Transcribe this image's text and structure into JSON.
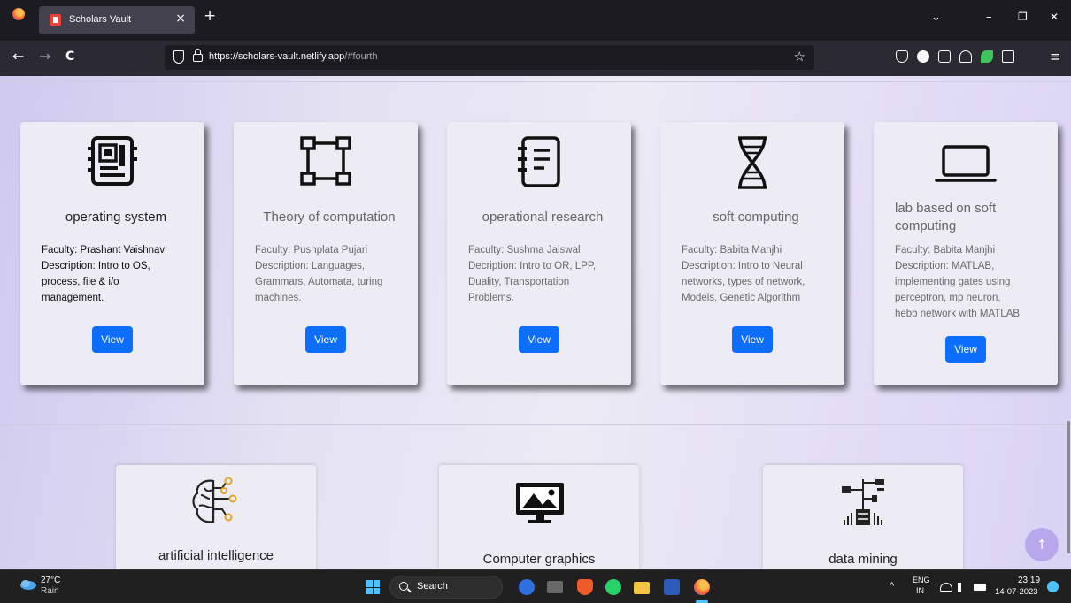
{
  "browser": {
    "tab_title": "Scholars Vault",
    "tab_close": "×",
    "new_tab": "+",
    "url_host": "https://scholars-vault.netlify.app",
    "url_path": "/#fourth",
    "nav_back": "←",
    "nav_forward": "→",
    "nav_reload": "C",
    "bookmark_star": "☆",
    "window_controls": {
      "list": "⌄",
      "minimize": "–",
      "restore": "❐",
      "close": "✕"
    },
    "menu": "≡"
  },
  "courses": [
    {
      "title": "operating system",
      "desc_lines": [
        "Faculty: Prashant Vaishnav",
        "Description: Intro to OS,",
        "process, file & i/o",
        "management."
      ],
      "button": "View",
      "icon": "circuit-board-icon"
    },
    {
      "title": "Theory of computation",
      "desc_lines": [
        "Faculty: Pushplata Pujari",
        "Description: Languages,",
        "Grammars, Automata, turing",
        "machines."
      ],
      "button": "View",
      "icon": "nodes-square-icon"
    },
    {
      "title": "operational research",
      "desc_lines": [
        "Faculty: Sushma Jaiswal",
        "Decription: Intro to OR, LPP,",
        "Duality, Transportation",
        "Problems."
      ],
      "button": "View",
      "icon": "notebook-icon"
    },
    {
      "title": "soft computing",
      "desc_lines": [
        "Faculty: Babita Manjhi",
        "Description: Intro to Neural",
        "networks, types of network,",
        "Models, Genetic Algorithm"
      ],
      "button": "View",
      "icon": "dna-icon"
    },
    {
      "title": "lab based on soft computing",
      "desc_lines": [
        "Faculty: Babita Manjhi",
        "Description: MATLAB,",
        "implementing gates using",
        "perceptron, mp neuron,",
        "hebb network with MATLAB"
      ],
      "button": "View",
      "icon": "laptop-icon"
    }
  ],
  "bottom_courses": [
    {
      "title": "artificial intelligence",
      "icon": "brain-circuit-icon"
    },
    {
      "title": "Computer graphics",
      "icon": "monitor-image-icon"
    },
    {
      "title": "data mining",
      "icon": "data-tree-icon"
    }
  ],
  "scroll_top": "↑",
  "taskbar": {
    "weather_temp": "27°C",
    "weather_desc": "Rain",
    "search_placeholder": "Search",
    "lang_top": "ENG",
    "lang_bottom": "IN",
    "time": "23:19",
    "date": "14-07-2023",
    "chevron": "^"
  },
  "colors": {
    "accent_button": "#0d6efd",
    "browser_dark": "#1c1b22",
    "toolbar": "#2b2a33",
    "taskbar": "#202020",
    "scroll_top_bg": "#b6a8ea"
  }
}
